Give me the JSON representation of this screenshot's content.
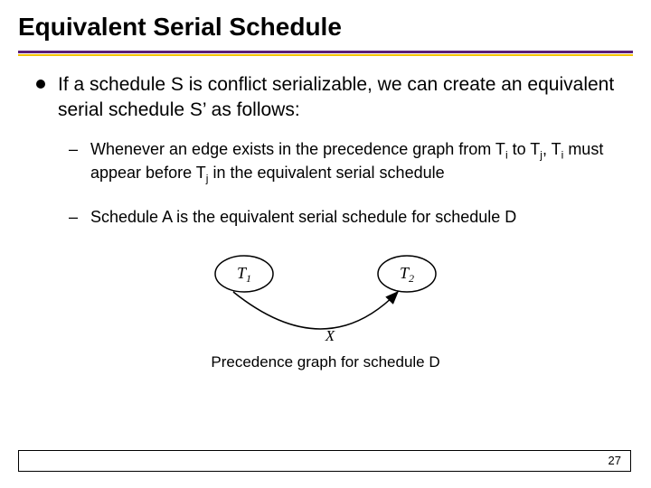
{
  "title": "Equivalent Serial Schedule",
  "bullet_main": "If a schedule S is conflict serializable, we can create an equivalent serial schedule S’ as follows:",
  "sub1_prefix": "Whenever an edge exists in the precedence graph from T",
  "sub1_mid1": " to T",
  "sub1_mid2": ", T",
  "sub1_mid3": " must appear before T",
  "sub1_suffix": " in the equivalent serial schedule",
  "idx_i": "i",
  "idx_j": "j",
  "sub2": "Schedule A is the equivalent serial schedule for schedule D",
  "node1": "T",
  "node1_sub": "1",
  "node2": "T",
  "node2_sub": "2",
  "edge_label": "X",
  "caption": "Precedence graph for schedule D",
  "page_number": "27"
}
